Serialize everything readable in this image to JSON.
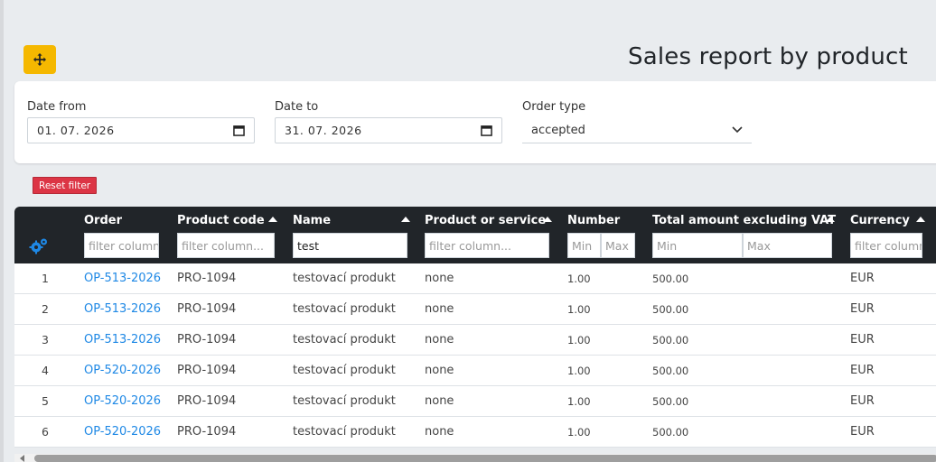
{
  "page": {
    "title": "Sales report by product"
  },
  "filters": {
    "date_from_label": "Date from",
    "date_from_value": "01. 07. 2026",
    "date_to_label": "Date to",
    "date_to_value": "31. 07. 2026",
    "order_type_label": "Order type",
    "order_type_value": "accepted",
    "reset_label": "Reset filter"
  },
  "table": {
    "columns": [
      {
        "label": "Order",
        "filter_placeholder": "filter column..."
      },
      {
        "label": "Product code",
        "filter_placeholder": "filter column..."
      },
      {
        "label": "Name",
        "filter_value": "test"
      },
      {
        "label": "Product or service",
        "filter_placeholder": "filter column..."
      },
      {
        "label": "Number",
        "min_placeholder": "Min",
        "max_placeholder": "Max"
      },
      {
        "label": "Total amount excluding VAT",
        "min_placeholder": "Min",
        "max_placeholder": "Max"
      },
      {
        "label": "Currency",
        "filter_placeholder": "filter column..."
      }
    ],
    "rows": [
      {
        "idx": "1",
        "order": "OP-513-2026",
        "code": "PRO-1094",
        "name": "testovací produkt",
        "type": "none",
        "number": "1.00",
        "total": "500.00",
        "currency": "EUR"
      },
      {
        "idx": "2",
        "order": "OP-513-2026",
        "code": "PRO-1094",
        "name": "testovací produkt",
        "type": "none",
        "number": "1.00",
        "total": "500.00",
        "currency": "EUR"
      },
      {
        "idx": "3",
        "order": "OP-513-2026",
        "code": "PRO-1094",
        "name": "testovací produkt",
        "type": "none",
        "number": "1.00",
        "total": "500.00",
        "currency": "EUR"
      },
      {
        "idx": "4",
        "order": "OP-520-2026",
        "code": "PRO-1094",
        "name": "testovací produkt",
        "type": "none",
        "number": "1.00",
        "total": "500.00",
        "currency": "EUR"
      },
      {
        "idx": "5",
        "order": "OP-520-2026",
        "code": "PRO-1094",
        "name": "testovací produkt",
        "type": "none",
        "number": "1.00",
        "total": "500.00",
        "currency": "EUR"
      },
      {
        "idx": "6",
        "order": "OP-520-2026",
        "code": "PRO-1094",
        "name": "testovací produkt",
        "type": "none",
        "number": "1.00",
        "total": "500.00",
        "currency": "EUR"
      }
    ]
  },
  "icons": {
    "move": "move-arrows-icon",
    "calendar": "calendar-icon",
    "chevron": "chevron-down-icon",
    "settings": "gears-icon",
    "sort": "sort-up-icon"
  },
  "colors": {
    "accent": "#f5b800",
    "danger": "#dc3545",
    "link": "#1e88e5",
    "header_bg": "#212529"
  }
}
